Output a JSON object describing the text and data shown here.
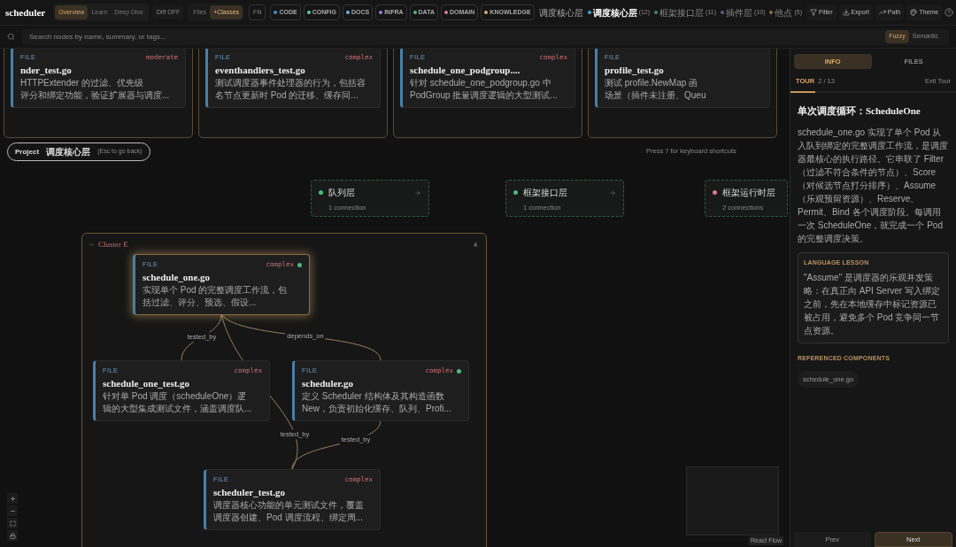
{
  "header": {
    "logo": "scheduler",
    "modes": [
      {
        "label": "Overview",
        "selected": true
      },
      {
        "label": "Learn",
        "selected": false
      },
      {
        "label": "Deep Dive",
        "selected": false
      }
    ],
    "diff": "Diff OFF",
    "views": [
      {
        "label": "Files",
        "selected": false
      },
      {
        "label": "+Classes",
        "selected": true
      }
    ],
    "fn": "FN",
    "categories": [
      {
        "label": "CODE",
        "color": "#4a8fc4"
      },
      {
        "label": "CONFIG",
        "color": "#4fd1c5"
      },
      {
        "label": "DOCS",
        "color": "#63b3ed"
      },
      {
        "label": "INFRA",
        "color": "#9f7aea"
      },
      {
        "label": "DATA",
        "color": "#48bb78"
      },
      {
        "label": "DOMAIN",
        "color": "#e07a8a"
      },
      {
        "label": "KNOWLEDGE",
        "color": "#e0a96d"
      }
    ],
    "current_layer": "调度核心层",
    "layers": [
      {
        "label": "调度核心层",
        "count": "(12)",
        "color": "#4a9fd8",
        "selected": true
      },
      {
        "label": "框架接口层",
        "count": "(11)",
        "color": "#3f8a5f",
        "selected": false
      },
      {
        "label": "插件层",
        "count": "(10)",
        "color": "#5a5a8a",
        "selected": false
      },
      {
        "label": "他点",
        "count": "(5)",
        "color": "#8a7040",
        "selected": false
      }
    ],
    "actions": [
      {
        "label": "Filter",
        "kind": "filter"
      },
      {
        "label": "Export",
        "kind": "export"
      },
      {
        "label": "Path",
        "kind": "path"
      },
      {
        "label": "Theme",
        "kind": "theme"
      }
    ]
  },
  "search": {
    "placeholder": "Search nodes by name, summary, or tags...",
    "modes": [
      {
        "label": "Fuzzy",
        "selected": true
      },
      {
        "label": "Semantic",
        "selected": false
      }
    ]
  },
  "breadcrumb": {
    "root": "Project",
    "current": "调度核心层",
    "hint": "(Esc to go back)"
  },
  "shortcut_hint": "Press ? for keyboard shortcuts",
  "top_cards": [
    {
      "type": "FILE",
      "complexity": "moderate",
      "title": "nder_test.go",
      "summary_lines": [
        "HTTPExtender 的过滤、优先级",
        "评分和绑定功能，验证扩展器与调度..."
      ]
    },
    {
      "type": "FILE",
      "complexity": "complex",
      "title": "eventhandlers_test.go",
      "summary_lines": [
        "测试调度器事件处理器的行为，包括容",
        "名节点更新时 Pod 的迁移、缓存同..."
      ]
    },
    {
      "type": "FILE",
      "complexity": "complex",
      "title": "schedule_one_podgroup....",
      "summary_lines": [
        "针对 schedule_one_podgroup.go 中",
        "PodGroup 批量调度逻辑的大型测试..."
      ]
    },
    {
      "type": "FILE",
      "title": "profile_test.go",
      "summary_lines": [
        "测试 profile.NewMap 函",
        "场景（插件未注册、Queu"
      ]
    }
  ],
  "layer_nodes": [
    {
      "label": "队列层",
      "connections": "1 connection",
      "color": "#48bb78"
    },
    {
      "label": "框架接口层",
      "connections": "1 connection",
      "color": "#48bb78"
    },
    {
      "label": "框架运行时层",
      "connections": "2 connections",
      "color": "#e07a8a"
    }
  ],
  "cluster": {
    "title": "Cluster E",
    "count": "4",
    "expanded": true,
    "nodes": [
      {
        "type": "FILE",
        "complexity": "complex",
        "dot": true,
        "highlighted": true,
        "title": "schedule_one.go",
        "summary_lines": [
          "实现单个 Pod 的完整调度工作流，包",
          "括过滤、评分、预选、假设..."
        ]
      },
      {
        "type": "FILE",
        "complexity": "complex",
        "dot": false,
        "highlighted": false,
        "title": "schedule_one_test.go",
        "summary_lines": [
          "针对单 Pod 调度（scheduleOne）逻",
          "辑的大型集成测试文件，涵盖调度队..."
        ]
      },
      {
        "type": "FILE",
        "complexity": "complex",
        "dot": true,
        "highlighted": false,
        "title": "scheduler.go",
        "summary_lines": [
          "定义 Scheduler 结构体及其构造函数",
          "New，负责初始化缓存、队列、Profi..."
        ]
      },
      {
        "type": "FILE",
        "complexity": "complex",
        "dot": false,
        "highlighted": false,
        "title": "scheduler_test.go",
        "summary_lines": [
          "调度器核心功能的单元测试文件，覆盖",
          "调度器创建、Pod 调度流程、绑定周..."
        ]
      }
    ],
    "edges": [
      {
        "label": "tested_by"
      },
      {
        "label": "depends_on"
      },
      {
        "label": "tested_by"
      },
      {
        "label": "tested_by"
      }
    ]
  },
  "minimap": {
    "attribution": "React Flow"
  },
  "panel": {
    "tabs": [
      {
        "label": "INFO",
        "selected": true
      },
      {
        "label": "FILES",
        "selected": false
      }
    ],
    "tour": {
      "label": "TOUR",
      "step": "2 / 13",
      "exit": "Exit Tour",
      "level": 0.15
    },
    "title": "单次调度循环：ScheduleOne",
    "body": "schedule_one.go 实现了单个 Pod 从入队到绑定的完整调度工作流，是调度器最核心的执行路径。它串联了 Filter（过滤不符合条件的节点）、Score（对候选节点打分排序）、Assume（乐观预留资源）、Reserve、Permit、Bind 各个调度阶段。每调用一次 ScheduleOne，就完成一个 Pod 的完整调度决策。",
    "lesson": {
      "heading": "LANGUAGE LESSON",
      "text": "\"Assume\" 是调度器的乐观并发策略：在真正向 API Server 写入绑定之前，先在本地缓存中标记资源已被占用，避免多个 Pod 竞争同一节点资源。"
    },
    "references_heading": "REFERENCED COMPONENTS",
    "references": [
      "schedule_one.go"
    ],
    "nav": [
      {
        "label": "Prev",
        "kind": "prev"
      },
      {
        "label": "Next",
        "kind": "next"
      }
    ]
  }
}
